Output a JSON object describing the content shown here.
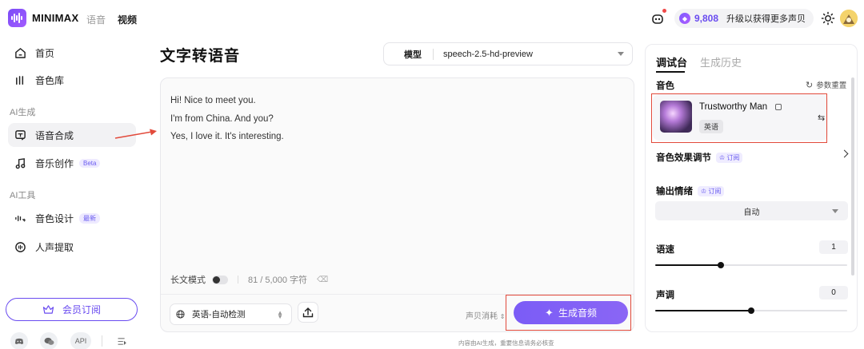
{
  "header": {
    "brand": "MINIMAX",
    "nav": [
      "语音",
      "视频"
    ],
    "credits": "9,808",
    "upgrade_label": "升级以获得更多声贝"
  },
  "sidebar": {
    "items": [
      {
        "label": "首页",
        "icon": "home-icon"
      },
      {
        "label": "音色库",
        "icon": "library-icon"
      },
      {
        "label": "语音合成",
        "icon": "tts-icon",
        "active": true
      },
      {
        "label": "音乐创作",
        "icon": "music-icon",
        "badge": "Beta"
      },
      {
        "label": "音色设计",
        "icon": "voice-design-icon",
        "badge": "最新"
      },
      {
        "label": "人声提取",
        "icon": "vocal-extract-icon"
      }
    ],
    "sections": [
      "AI生成",
      "AI工具"
    ],
    "vip_label": "会员订阅",
    "footer": [
      "discord-icon",
      "wechat-icon",
      "API",
      "changelog-icon"
    ]
  },
  "main": {
    "title": "文字转语音",
    "model_label": "模型",
    "model_value": "speech-2.5-hd-preview",
    "text_lines": [
      "Hi! Nice to meet you.",
      "I'm from China. And you?",
      "Yes, I love it. It's interesting."
    ],
    "long_mode_label": "长文模式",
    "char_count": "81 / 5,000 字符",
    "language_value": "英语-自动检测",
    "cost_label": "声贝消耗",
    "generate_label": "生成音频",
    "disclaimer": "内容由AI生成，重要信息请务必核查"
  },
  "panel": {
    "tabs": [
      "调试台",
      "生成历史"
    ],
    "voice_label": "音色",
    "reset_label": "参数重置",
    "voice_name": "Trustworthy Man",
    "voice_lang": "英语",
    "effect_label": "音色效果调节",
    "subscribe_badge": "订阅",
    "emotion_label": "输出情绪",
    "emotion_value": "自动",
    "speed_label": "语速",
    "speed_value": "1",
    "pitch_label": "声调",
    "pitch_value": "0",
    "speed_level": 0.34,
    "pitch_level": 0.5
  },
  "colors": {
    "accent": "#6a4cf0",
    "highlight": "#e24a3b"
  }
}
